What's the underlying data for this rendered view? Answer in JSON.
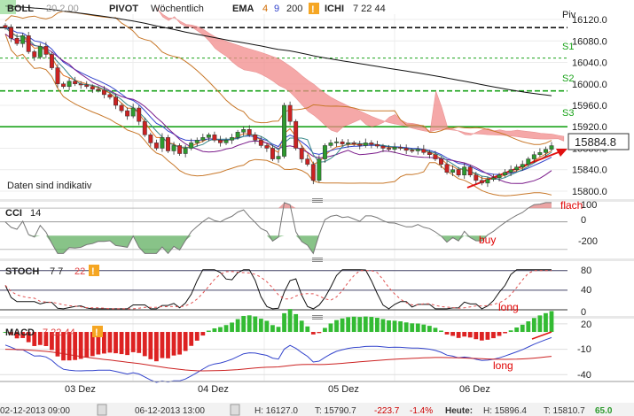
{
  "header": {
    "boll": {
      "label": "BOLL",
      "params": "20 2.00"
    },
    "pivot": {
      "label": "PIVOT",
      "params": "Wöchentlich"
    },
    "ema": {
      "label": "EMA",
      "p1": "4",
      "p2": "9",
      "p3": "200"
    },
    "ichi": {
      "label": "ICHI",
      "params": "7 22 44"
    },
    "warn": "!"
  },
  "main": {
    "note": "Daten sind indikativ",
    "current_price": "15884.8",
    "pivot_labels": {
      "piv": "Piv",
      "s1": "S1",
      "s2": "S2",
      "s3": "S3"
    },
    "yticks": [
      "16120.0",
      "16080.0",
      "16040.0",
      "16000.0",
      "15960.0",
      "15920.0",
      "15880.0",
      "15840.0",
      "15800.0"
    ],
    "pivot_levels": {
      "piv": 16105,
      "s1": 16048,
      "s2": 15987,
      "s3": 15920
    }
  },
  "cci": {
    "label": "CCI",
    "params": "14",
    "ticks": [
      "100",
      "0",
      "-200"
    ],
    "ann_flach": "flach",
    "ann_buy": "buy"
  },
  "stoch": {
    "label": "STOCH",
    "params": "7 7",
    "p3": "22",
    "warn": "!",
    "ticks": [
      "80",
      "40",
      "0"
    ],
    "ann_long": "long"
  },
  "macd": {
    "label": "MACD",
    "params": "7 22 44",
    "warn": "!",
    "ticks": [
      "20",
      "-10",
      "-40"
    ],
    "ann_long": "long"
  },
  "xaxis": {
    "labels": [
      "03 Dez",
      "04 Dez",
      "05 Dez",
      "06 Dez"
    ]
  },
  "status": {
    "from": "02-12-2013 09:00",
    "to": "06-12-2013 13:00",
    "h": "H: 16127.0",
    "t": "T: 15790.7",
    "chg": "-223.7",
    "pct": "-1.4%",
    "heute": "Heute:",
    "hh": "H: 15896.4",
    "ht": "T: 15810.7",
    "val": "65.0"
  },
  "colors": {
    "candle_up": "#2e9a2e",
    "candle_down": "#cc2222",
    "cloud": "#f28b8b",
    "pivot_green": "#1aa31a",
    "macd_pos": "#33bb33",
    "macd_neg": "#dd2222"
  },
  "chart_data": {
    "type": "candlestick",
    "ylim": [
      15790,
      16130
    ],
    "close": [
      16105,
      16085,
      16075,
      16090,
      16060,
      16050,
      16070,
      16055,
      16030,
      16000,
      15995,
      16005,
      16000,
      15998,
      15995,
      15990,
      15988,
      15980,
      15975,
      15960,
      15950,
      15940,
      15955,
      15930,
      15905,
      15890,
      15880,
      15900,
      15875,
      15885,
      15870,
      15880,
      15890,
      15895,
      15900,
      15905,
      15895,
      15890,
      15895,
      15900,
      15910,
      15915,
      15905,
      15895,
      15885,
      15880,
      15860,
      15865,
      15960,
      15930,
      15880,
      15860,
      15850,
      15820,
      15860,
      15885,
      15890,
      15892,
      15888,
      15890,
      15888,
      15885,
      15890,
      15887,
      15884,
      15880,
      15878,
      15882,
      15880,
      15876,
      15875,
      15878,
      15872,
      15868,
      15860,
      15850,
      15835,
      15840,
      15830,
      15845,
      15830,
      15820,
      15815,
      15822,
      15825,
      15830,
      15835,
      15840,
      15845,
      15850,
      15860,
      15868,
      15872,
      15878,
      15884.8
    ]
  }
}
